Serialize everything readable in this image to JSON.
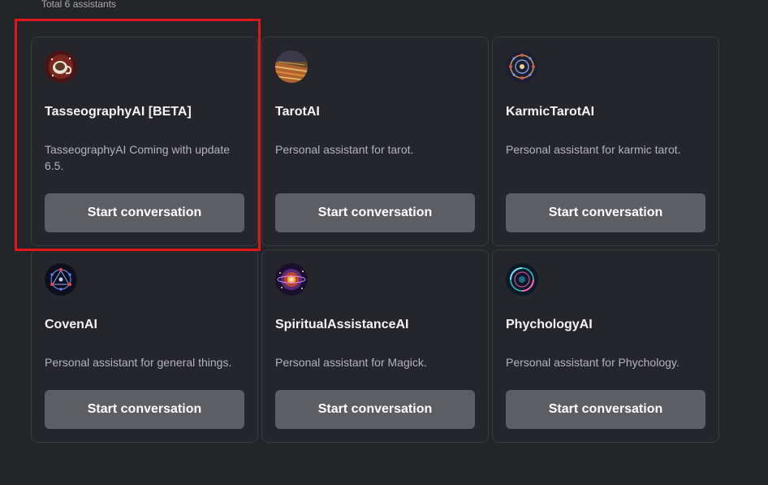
{
  "header": {
    "total_text": "Total 6 assistants"
  },
  "colors": {
    "highlight": "#e0161a",
    "button": "#5d5e63",
    "background": "#242529"
  },
  "assistants": [
    {
      "name": "TasseographyAI [BETA]",
      "description": "TasseographyAI Coming with update 6.5.",
      "button_label": "Start conversation",
      "icon": "tea-cup-icon"
    },
    {
      "name": "TarotAI",
      "description": "Personal assistant for tarot.",
      "button_label": "Start conversation",
      "icon": "tarot-cards-icon"
    },
    {
      "name": "KarmicTarotAI",
      "description": "Personal assistant for karmic tarot.",
      "button_label": "Start conversation",
      "icon": "karmic-wheel-icon"
    },
    {
      "name": "CovenAI",
      "description": "Personal assistant for general things.",
      "button_label": "Start conversation",
      "icon": "coven-circle-icon"
    },
    {
      "name": "SpiritualAssistanceAI",
      "description": "Personal assistant for Magick.",
      "button_label": "Start conversation",
      "icon": "spiritual-orb-icon"
    },
    {
      "name": "PhychologyAI",
      "description": "Personal assistant for Phychology.",
      "button_label": "Start conversation",
      "icon": "psychology-circle-icon"
    }
  ]
}
